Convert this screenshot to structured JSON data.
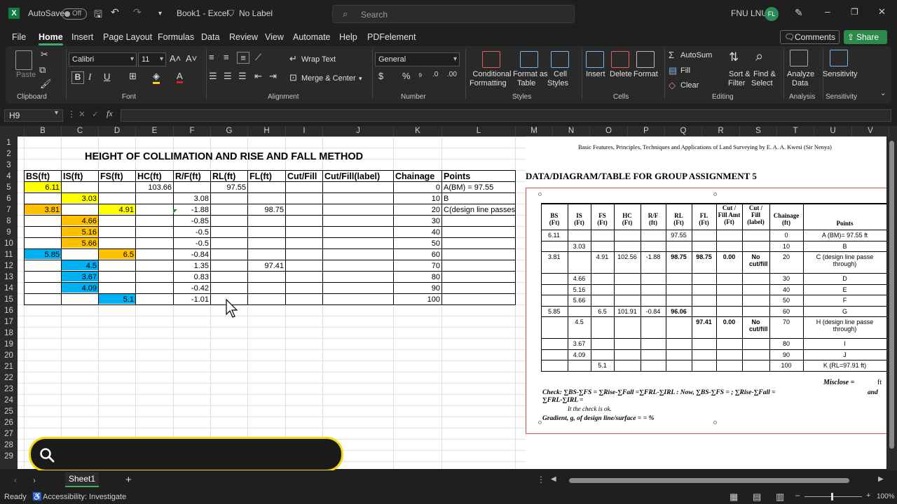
{
  "titlebar": {
    "autosave": "AutoSave",
    "toggle": "Off",
    "doc_title": "Book1 - Excel",
    "label": "No Label",
    "search_placeholder": "Search",
    "user": "FNU LNU",
    "initials": "FL"
  },
  "menu": [
    "File",
    "Home",
    "Insert",
    "Page Layout",
    "Formulas",
    "Data",
    "Review",
    "View",
    "Automate",
    "Help",
    "PDFelement"
  ],
  "menu_active": "Home",
  "comments": "Comments",
  "share": "Share",
  "ribbon": {
    "paste": "Paste",
    "clipboard": "Clipboard",
    "font_name": "Calibri",
    "font_size": "11",
    "font": "Font",
    "wrap_text": "Wrap Text",
    "merge_center": "Merge & Center",
    "alignment": "Alignment",
    "number_format": "General",
    "number": "Number",
    "cond_format": [
      "Conditional",
      "Formatting"
    ],
    "format_table": [
      "Format as",
      "Table"
    ],
    "cell_styles": [
      "Cell",
      "Styles"
    ],
    "styles": "Styles",
    "insert": "Insert",
    "delete": "Delete",
    "format": "Format",
    "cells": "Cells",
    "autosum": "AutoSum",
    "fill": "Fill",
    "clear": "Clear",
    "sort_filter": [
      "Sort &",
      "Filter"
    ],
    "find_select": [
      "Find &",
      "Select"
    ],
    "editing": "Editing",
    "analyze": [
      "Analyze",
      "Data"
    ],
    "analysis": "Analysis",
    "sensitivity_btn": "Sensitivity",
    "sensitivity": "Sensitivity",
    "btn_bold": "B",
    "btn_italic": "I",
    "btn_underline": "U",
    "btn_percent": "%"
  },
  "namebox": "H9",
  "columns": [
    "B",
    "C",
    "D",
    "E",
    "F",
    "G",
    "H",
    "I",
    "J",
    "K",
    "L",
    "M",
    "N",
    "O",
    "P",
    "Q",
    "R",
    "S",
    "T",
    "U",
    "V"
  ],
  "rows": [
    "1",
    "2",
    "3",
    "4",
    "5",
    "6",
    "7",
    "8",
    "9",
    "10",
    "11",
    "12",
    "13",
    "14",
    "15",
    "16",
    "17",
    "18",
    "19",
    "20",
    "21",
    "22",
    "23",
    "24",
    "25",
    "26",
    "27",
    "28",
    "29"
  ],
  "sheet": {
    "title": "HEIGHT OF COLLIMATION AND RISE AND FALL METHOD",
    "headers": [
      "BS(ft)",
      "IS(ft)",
      "FS(ft)",
      "HC(ft)",
      "R/F(ft)",
      "RL(ft)",
      "FL(ft)",
      "Cut/Fill",
      "Cut/Fill(label)",
      "Chainage",
      "Points"
    ],
    "rows": [
      {
        "B": "6.11",
        "C": "",
        "D": "",
        "E": "103.66",
        "F": "",
        "G": "97.55",
        "H": "",
        "K": "0",
        "L": "A(BM) = 97.55"
      },
      {
        "B": "",
        "C": "3.03",
        "D": "",
        "E": "",
        "F": "3.08",
        "G": "",
        "H": "",
        "K": "10",
        "L": "B"
      },
      {
        "B": "3.81",
        "C": "",
        "D": "4.91",
        "E": "",
        "F": "-1.88",
        "G": "",
        "H": "98.75",
        "K": "20",
        "L": "C(design line passes"
      },
      {
        "B": "",
        "C": "4.66",
        "D": "",
        "E": "",
        "F": "-0.85",
        "G": "",
        "H": "",
        "K": "30",
        "L": ""
      },
      {
        "B": "",
        "C": "5.16",
        "D": "",
        "E": "",
        "F": "-0.5",
        "G": "",
        "H": "",
        "K": "40",
        "L": ""
      },
      {
        "B": "",
        "C": "5.66",
        "D": "",
        "E": "",
        "F": "-0.5",
        "G": "",
        "H": "",
        "K": "50",
        "L": ""
      },
      {
        "B": "5.85",
        "C": "",
        "D": "6.5",
        "E": "",
        "F": "-0.84",
        "G": "",
        "H": "",
        "K": "60",
        "L": ""
      },
      {
        "B": "",
        "C": "4.5",
        "D": "",
        "E": "",
        "F": "1.35",
        "G": "",
        "H": "97.41",
        "K": "70",
        "L": ""
      },
      {
        "B": "",
        "C": "3.67",
        "D": "",
        "E": "",
        "F": "0.83",
        "G": "",
        "H": "",
        "K": "80",
        "L": ""
      },
      {
        "B": "",
        "C": "4.09",
        "D": "",
        "E": "",
        "F": "-0.42",
        "G": "",
        "H": "",
        "K": "90",
        "L": ""
      },
      {
        "B": "",
        "C": "",
        "D": "5.1",
        "E": "",
        "F": "-1.01",
        "G": "",
        "H": "",
        "K": "100",
        "L": ""
      }
    ]
  },
  "image": {
    "ref": "Basic Features, Principles, Techniques and Applications of Land Surveying by E. A. A. Kwesi (Sir Nenya)",
    "heading": "DATA/DIAGRAM/TABLE FOR GROUP ASSIGNMENT 5",
    "headers": [
      [
        "BS",
        "(Ft)"
      ],
      [
        "IS",
        "(Ft)"
      ],
      [
        "FS",
        "(Ft)"
      ],
      [
        "HC",
        "(Ft)"
      ],
      [
        "R/F",
        "(ft)"
      ],
      [
        "RL",
        "(Ft)"
      ],
      [
        "FL",
        "(Ft)"
      ],
      [
        "Cut /",
        "Fill Amt",
        "(Ft)"
      ],
      [
        "Cut /",
        "Fill",
        "(label)"
      ],
      [
        "Chainage",
        "(ft)"
      ],
      [
        "Points"
      ]
    ],
    "rows": [
      [
        "6.11",
        "",
        "",
        "",
        "",
        "97.55",
        "",
        "",
        "",
        "0",
        "A (BM)= 97.55 ft"
      ],
      [
        "",
        "3.03",
        "",
        "",
        "",
        "",
        "",
        "",
        "",
        "10",
        "B"
      ],
      [
        "3.81",
        "",
        "4.91",
        "102.56",
        "-1.88",
        "98.75",
        "98.75",
        "0.00",
        "No cut/fill",
        "20",
        "C (design line passe through)"
      ],
      [
        "",
        "4.66",
        "",
        "",
        "",
        "",
        "",
        "",
        "",
        "30",
        "D"
      ],
      [
        "",
        "5.16",
        "",
        "",
        "",
        "",
        "",
        "",
        "",
        "40",
        "E"
      ],
      [
        "",
        "5.66",
        "",
        "",
        "",
        "",
        "",
        "",
        "",
        "50",
        "F"
      ],
      [
        "5.85",
        "",
        "6.5",
        "101.91",
        "-0.84",
        "96.06",
        "",
        "",
        "",
        "60",
        "G"
      ],
      [
        "",
        "4.5",
        "",
        "",
        "",
        "",
        "97.41",
        "0.00",
        "No cut/fill",
        "70",
        "H (design line passe through)"
      ],
      [
        "",
        "3.67",
        "",
        "",
        "",
        "",
        "",
        "",
        "",
        "80",
        "I"
      ],
      [
        "",
        "4.09",
        "",
        "",
        "",
        "",
        "",
        "",
        "",
        "90",
        "J"
      ],
      [
        "",
        "",
        "5.1",
        "",
        "",
        "",
        "",
        "",
        "",
        "100",
        "K (RL=97.91 ft)"
      ]
    ],
    "misclose": "Misclose =",
    "misclose_unit": "ft",
    "check_line1": "Check: ∑BS-∑FS = ∑Rise-∑Fall =∑FRL-∑IRL : Now,    ∑BS-∑FS =              ; ∑Rise-∑Fall =",
    "check_and": "and",
    "check_line2": "∑FRL-∑IRL =",
    "check_line3": "It the check is ok.",
    "gradient": "Gradient, g, of design line/surface =          =          %"
  },
  "sheet_tab": "Sheet1",
  "status": {
    "ready": "Ready",
    "accessibility": "Accessibility: Investigate",
    "zoom": "100%"
  }
}
